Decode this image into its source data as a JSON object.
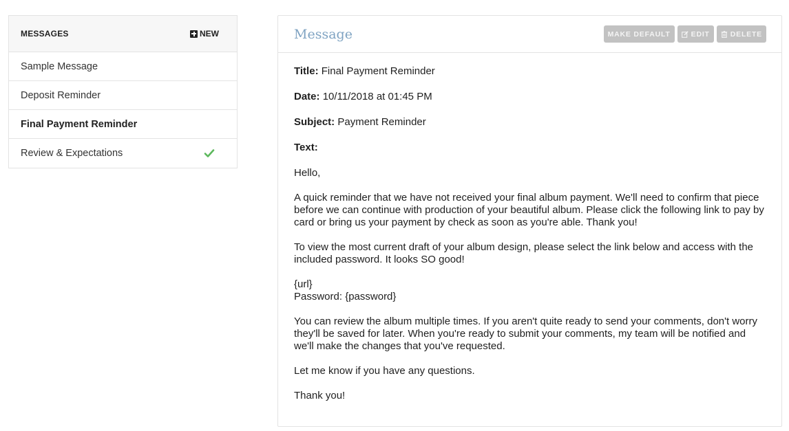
{
  "sidebar": {
    "title": "MESSAGES",
    "new_label": "NEW",
    "items": [
      {
        "label": "Sample Message"
      },
      {
        "label": "Deposit Reminder"
      },
      {
        "label": "Final Payment Reminder",
        "active": true
      },
      {
        "label": "Review & Expectations",
        "default": true
      }
    ]
  },
  "message": {
    "panel_title": "Message",
    "actions": {
      "make_default": "MAKE DEFAULT",
      "edit": "EDIT",
      "delete": "DELETE"
    },
    "title_label": "Title:",
    "title_value": "Final Payment Reminder",
    "date_label": "Date:",
    "date_value": "10/11/2018 at 01:45 PM",
    "subject_label": "Subject:",
    "subject_value": "Payment Reminder",
    "text_label": "Text:",
    "body": {
      "greeting": "Hello,",
      "p1": "A quick reminder that we have not received your final album payment. We'll need to confirm that piece before we can continue with production of your beautiful album. Please click the following link to pay by card or bring us your payment by check as soon as you're able. Thank you!",
      "p2": "To view the most current draft of your album design, please select the link below and access with the included password. It looks SO good!",
      "url_line": "{url}",
      "password_line": "Password: {password}",
      "p3": "You can review the album multiple times. If you aren't quite ready to send your comments, don't worry they'll be saved for later. When you're ready to submit your comments, my team will be notified and we'll make the changes that you've requested.",
      "p4": "Let me know if you have any questions.",
      "closing": "Thank you!"
    }
  },
  "colors": {
    "accent_title": "#7fa3c2",
    "check": "#5cb85c",
    "button_bg": "#c2c2c2"
  },
  "icons": {
    "new": "plus-square-icon",
    "default_marker": "check-icon",
    "edit": "edit-icon",
    "delete": "trash-icon"
  }
}
